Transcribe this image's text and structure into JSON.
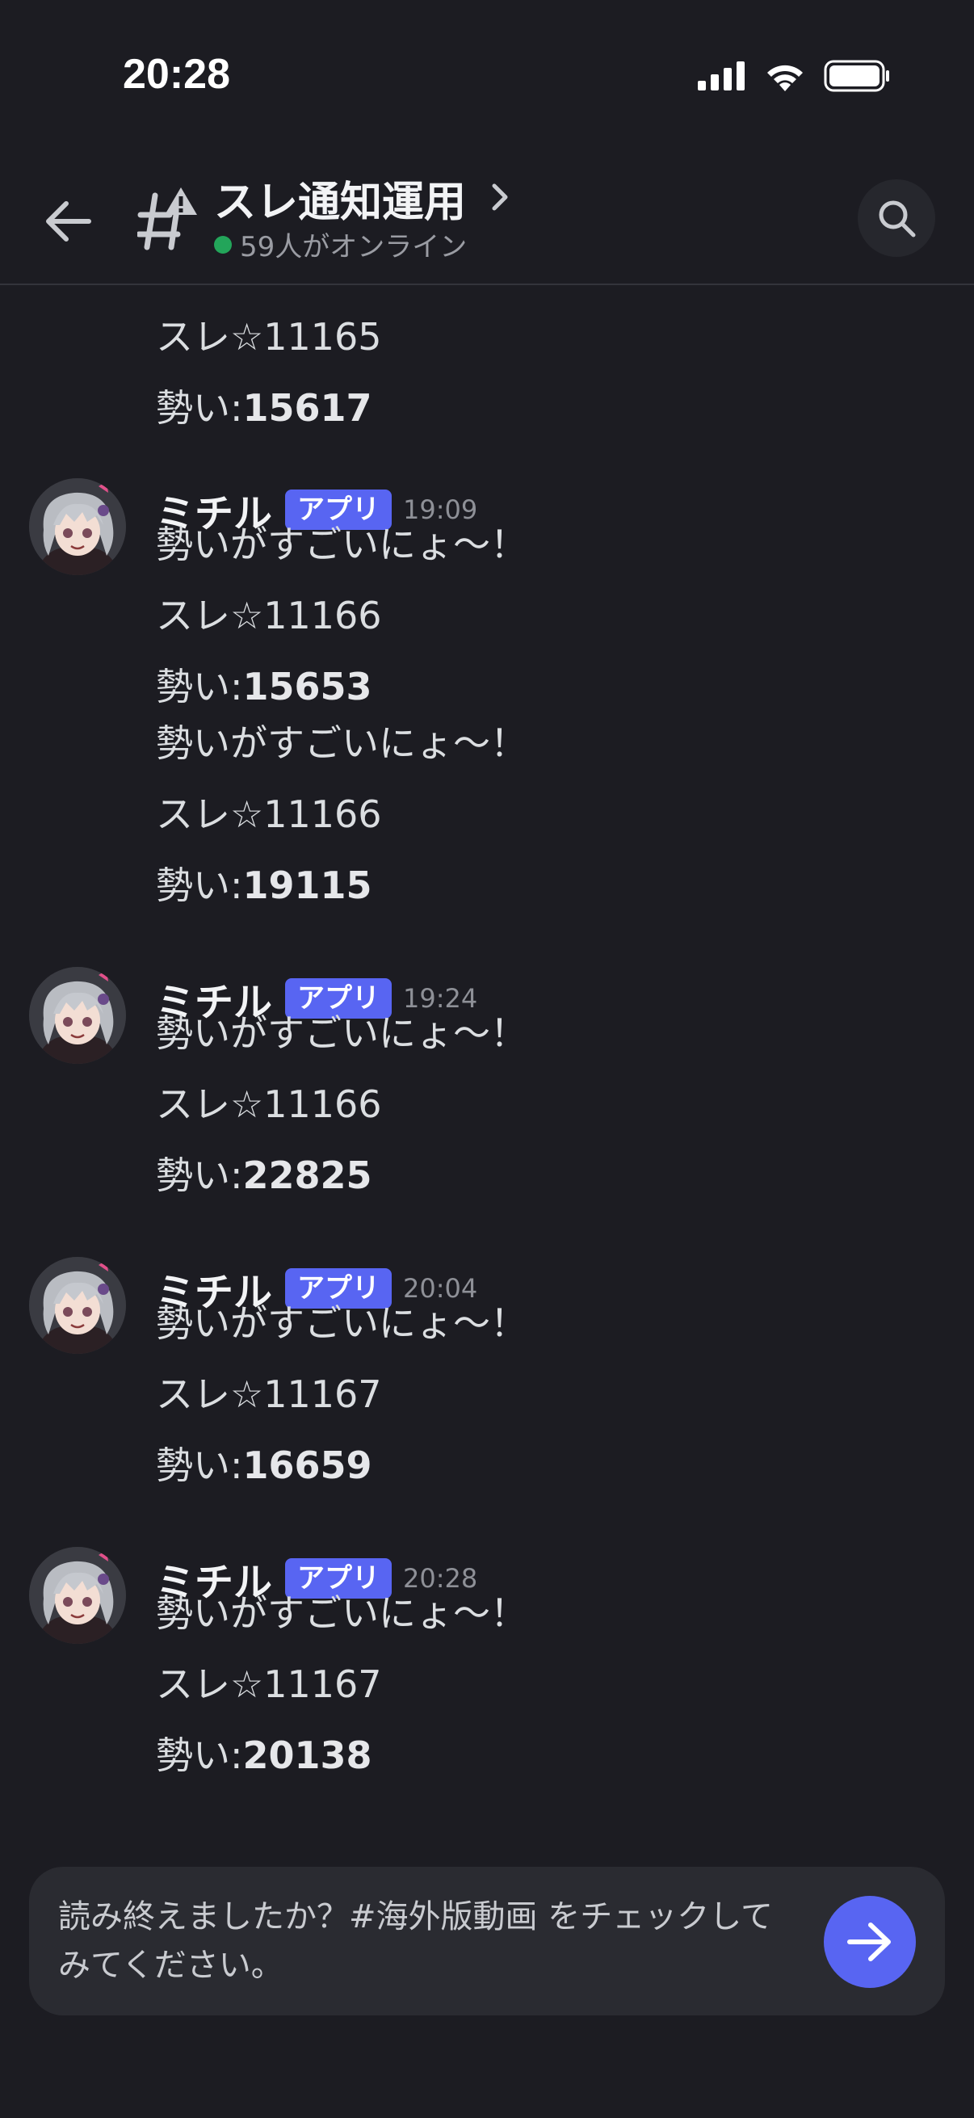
{
  "status_bar": {
    "time": "20:28",
    "icons": [
      "cellular-signal-icon",
      "wifi-icon",
      "battery-icon"
    ]
  },
  "header": {
    "back_icon": "arrow-left-icon",
    "channel_icon": "thread-hash-warning-icon",
    "title": "スレ通知運用",
    "chevron_icon": "chevron-right-icon",
    "online_text": "59人がオンライン",
    "online_color": "#23a55a",
    "search_icon": "search-icon"
  },
  "messages": {
    "continuation": {
      "thread": "スレ☆11165",
      "momentum_label": "勢い:",
      "momentum_value": "15617"
    },
    "groups": [
      {
        "username": "ミチル",
        "badge": "アプリ",
        "time": "19:09",
        "posts": [
          {
            "text": "勢いがすごいにょ〜！",
            "thread": "スレ☆11166",
            "momentum_label": "勢い:",
            "momentum_value": "15653"
          },
          {
            "text": "勢いがすごいにょ〜！",
            "thread": "スレ☆11166",
            "momentum_label": "勢い:",
            "momentum_value": "19115"
          }
        ]
      },
      {
        "username": "ミチル",
        "badge": "アプリ",
        "time": "19:24",
        "posts": [
          {
            "text": "勢いがすごいにょ〜！",
            "thread": "スレ☆11166",
            "momentum_label": "勢い:",
            "momentum_value": "22825"
          }
        ]
      },
      {
        "username": "ミチル",
        "badge": "アプリ",
        "time": "20:04",
        "posts": [
          {
            "text": "勢いがすごいにょ〜！",
            "thread": "スレ☆11167",
            "momentum_label": "勢い:",
            "momentum_value": "16659"
          }
        ]
      },
      {
        "username": "ミチル",
        "badge": "アプリ",
        "time": "20:28",
        "posts": [
          {
            "text": "勢いがすごいにょ〜！",
            "thread": "スレ☆11167",
            "momentum_label": "勢い:",
            "momentum_value": "20138"
          }
        ]
      }
    ]
  },
  "composer": {
    "prompt_text": "読み終えましたか？#海外版動画 をチェックしてみてください。",
    "send_icon": "arrow-right-icon"
  },
  "colors": {
    "background": "#1c1c22",
    "accent": "#5865f2",
    "online": "#23a55a"
  }
}
